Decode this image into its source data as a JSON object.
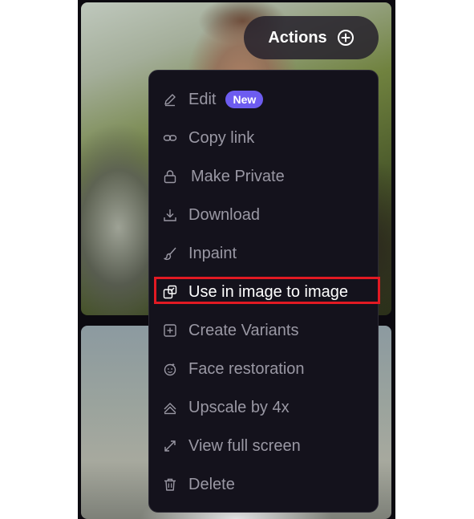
{
  "actions_button": {
    "label": "Actions",
    "icon": "plus-circle-icon"
  },
  "menu": {
    "items": [
      {
        "label": "Edit",
        "icon": "pencil-icon",
        "badge": "New"
      },
      {
        "label": "Copy link",
        "icon": "link-icon"
      },
      {
        "label": "Make Private",
        "icon": "lock-icon"
      },
      {
        "label": "Download",
        "icon": "download-icon"
      },
      {
        "label": "Inpaint",
        "icon": "brush-icon"
      },
      {
        "label": "Use in image to image",
        "icon": "image-to-image-icon",
        "highlighted": true
      },
      {
        "label": "Create Variants",
        "icon": "plus-square-icon"
      },
      {
        "label": "Face restoration",
        "icon": "face-restore-icon"
      },
      {
        "label": "Upscale by 4x",
        "icon": "upscale-icon"
      },
      {
        "label": "View full screen",
        "icon": "expand-icon"
      },
      {
        "label": "Delete",
        "icon": "trash-icon"
      }
    ]
  },
  "colors": {
    "menu_background": "#14121c",
    "menu_text": "#9a98a4",
    "highlight_text": "#ffffff",
    "highlight_border": "#e21a23",
    "badge_background": "#6d5cf0"
  }
}
